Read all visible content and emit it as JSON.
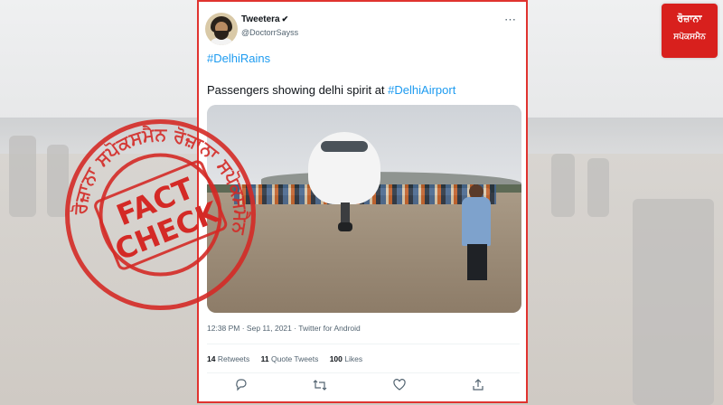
{
  "tweet": {
    "name": "Tweetera",
    "handle": "@DoctorrSayss",
    "hashtag_line": "#DelhiRains",
    "text_prefix": "Passengers showing delhi spirit at ",
    "text_hashtag": "#DelhiAirport",
    "meta": "12:38 PM · Sep 11, 2021 · Twitter for Android",
    "stats": {
      "retweets_count": "14",
      "retweets_label": "Retweets",
      "quotes_count": "11",
      "quotes_label": "Quote Tweets",
      "likes_count": "100",
      "likes_label": "Likes"
    }
  },
  "stamp": {
    "line1": "FACT",
    "line2": "CHECK",
    "ring_text": "ਰੋਜ਼ਾਨਾ ਸਪੋਕਸਮੈਨ ਰੋਜ਼ਾਨਾ ਸਪੋਕਸਮੈਨ"
  },
  "logo": {
    "line1": "ਰੋਜ਼ਾਨਾ",
    "line2": "ਸਪੋਕਸਮੈਨ"
  },
  "colors": {
    "accent_red": "#e0332f",
    "twitter_blue": "#1d9bf0",
    "logo_red": "#d8201d"
  }
}
